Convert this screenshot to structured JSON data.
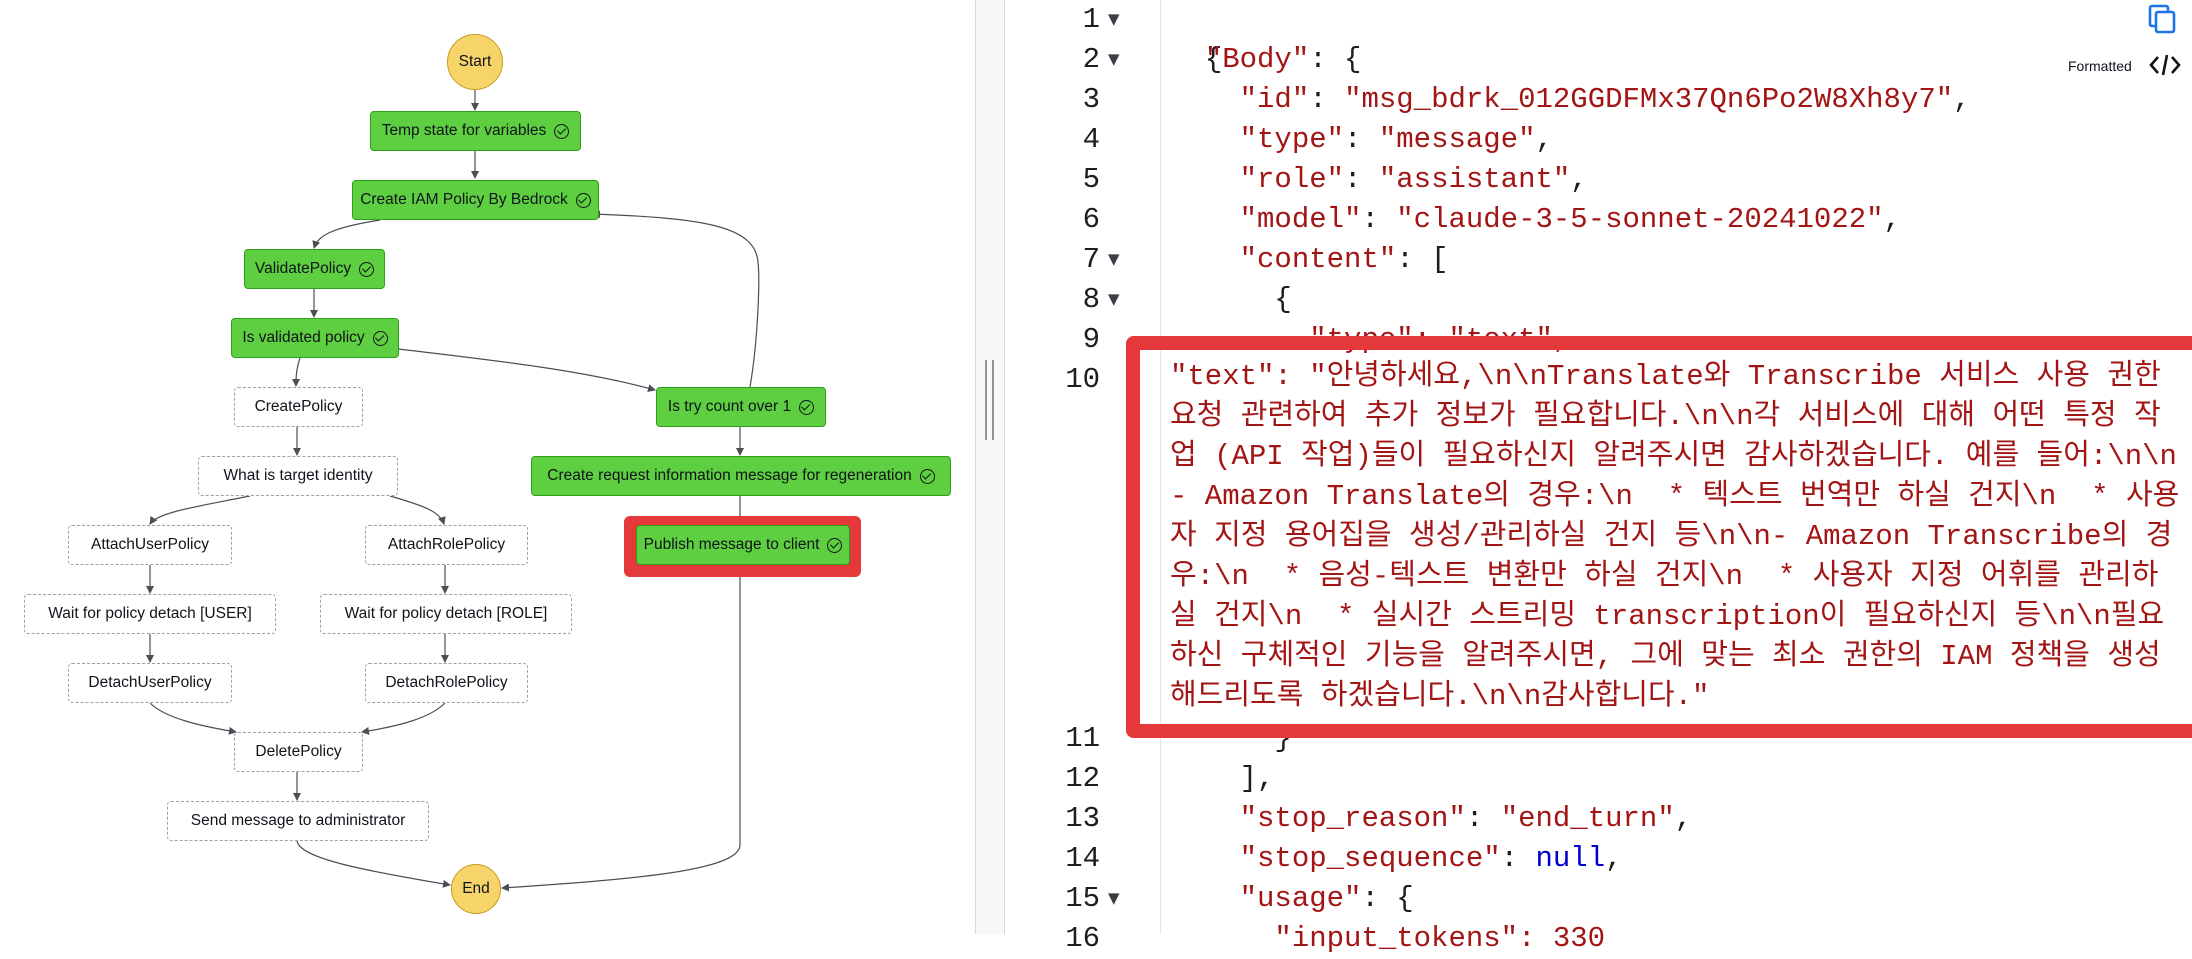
{
  "graph": {
    "nodes": {
      "start": "Start",
      "temp_state": "Temp state for variables",
      "create_iam": "Create IAM Policy By Bedrock",
      "validate": "ValidatePolicy",
      "is_validated": "Is validated policy",
      "create_policy": "CreatePolicy",
      "is_try_count": "Is try count over 1",
      "target_identity": "What is target identity",
      "create_request": "Create request information message for regeneration",
      "publish": "Publish message to client",
      "attach_user": "AttachUserPolicy",
      "attach_role": "AttachRolePolicy",
      "wait_user": "Wait for policy detach [USER]",
      "wait_role": "Wait for policy detach [ROLE]",
      "detach_user": "DetachUserPolicy",
      "detach_role": "DetachRolePolicy",
      "delete_policy": "DeletePolicy",
      "send_admin": "Send message to administrator",
      "end": "End"
    },
    "colors": {
      "succeeded": "#5ecf41",
      "terminal": "#f7d46a",
      "highlight": "#e5383b"
    }
  },
  "editor": {
    "toolbar": {
      "formatted_label": "Formatted",
      "copy_icon": "copy-icon",
      "code_icon": "code-icon"
    },
    "line_numbers": [
      "1",
      "2",
      "3",
      "4",
      "5",
      "6",
      "7",
      "8",
      "9",
      "10",
      "11",
      "12",
      "13",
      "14",
      "15",
      "16"
    ],
    "lines": {
      "l1": "{",
      "l2_key": "\"Body\"",
      "l2_rest": ": {",
      "l3_key": "\"id\"",
      "l3_val": "\"msg_bdrk_012GGDFMx37Qn6Po2W8Xh8y7\"",
      "l4_key": "\"type\"",
      "l4_val": "\"message\"",
      "l5_key": "\"role\"",
      "l5_val": "\"assistant\"",
      "l6_key": "\"model\"",
      "l6_val": "\"claude-3-5-sonnet-20241022\"",
      "l7_key": "\"content\"",
      "l7_rest": ": [",
      "l8": "{",
      "l9_ghost": "\"type\": \"text\",",
      "l10_text": "\"text\": \"안녕하세요,\\n\\nTranslate와 Transcribe 서비스 사용 권한 요청 관련하여 추가 정보가 필요합니다.\\n\\n각 서비스에 대해 어떤 특정 작업 (API 작업)들이 필요하신지 알려주시면 감사하겠습니다. 예를 들어:\\n\\n- Amazon Translate의 경우:\\n  * 텍스트 번역만 하실 건지\\n  * 사용자 지정 용어집을 생성/관리하실 건지 등\\n\\n- Amazon Transcribe의 경우:\\n  * 음성-텍스트 변환만 하실 건지\\n  * 사용자 지정 어휘를 관리하실 건지\\n  * 실시간 스트리밍 transcription이 필요하신지 등\\n\\n필요하신 구체적인 기능을 알려주시면, 그에 맞는 최소 권한의 IAM 정책을 생성해드리도록 하겠습니다.\\n\\n감사합니다.\"",
      "l11": "}",
      "l12": "],",
      "l13_key": "\"stop_reason\"",
      "l13_val": "\"end_turn\"",
      "l14_key": "\"stop_sequence\"",
      "l14_val": "null",
      "l15_key": "\"usage\"",
      "l15_rest": ": {",
      "l16_ghost": "\"input_tokens\": 330"
    }
  }
}
